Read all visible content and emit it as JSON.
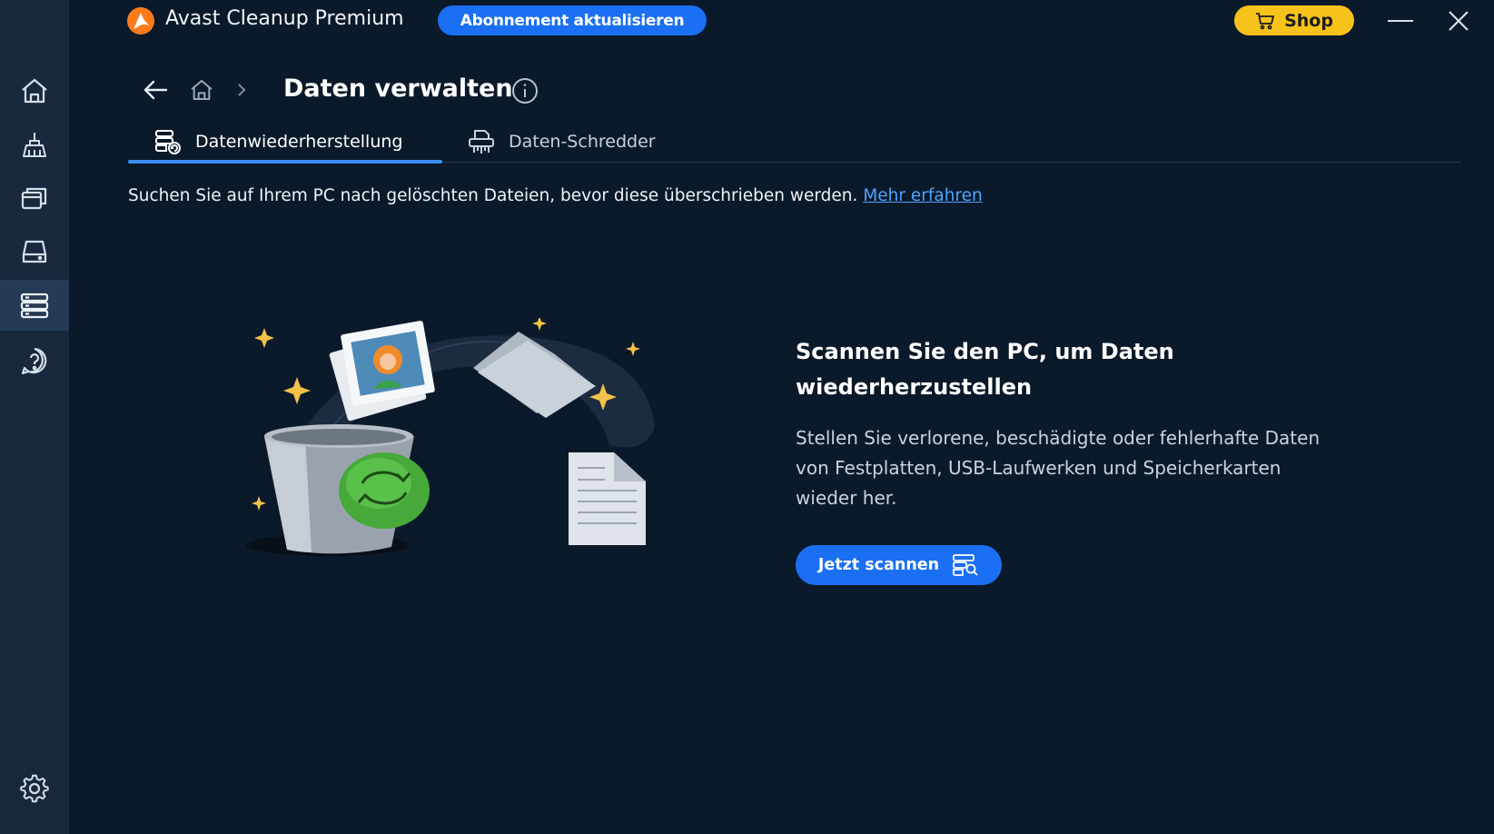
{
  "app": {
    "title": "Avast Cleanup Premium",
    "upgrade_label": "Abonnement aktualisieren",
    "shop_label": "Shop"
  },
  "sidebar": {
    "items": [
      {
        "icon": "home-icon",
        "active": false
      },
      {
        "icon": "broom-icon",
        "active": false
      },
      {
        "icon": "windows-icon",
        "active": false
      },
      {
        "icon": "drive-icon",
        "active": false
      },
      {
        "icon": "data-stack-icon",
        "active": true
      },
      {
        "icon": "help-icon",
        "active": false
      },
      {
        "icon": "gear-icon",
        "active": false
      }
    ]
  },
  "breadcrumb": {
    "title": "Daten verwalten"
  },
  "tabs": [
    {
      "label": "Datenwiederherstellung",
      "active": true,
      "icon": "data-recovery-icon"
    },
    {
      "label": "Daten-Schredder",
      "active": false,
      "icon": "shredder-icon"
    }
  ],
  "description": {
    "text": "Suchen Sie auf Ihrem PC nach gelöschten Dateien, bevor diese überschrieben werden.",
    "link": "Mehr erfahren"
  },
  "cta": {
    "title": "Scannen Sie den PC, um Daten wiederherzustellen",
    "body": "Stellen Sie verlorene, beschädigte oder fehlerhafte Daten von Festplatten, USB-Laufwerken und Speicherkarten wieder her.",
    "button": "Jetzt scannen"
  },
  "colors": {
    "accent": "#1a6ff2",
    "shop": "#f7c21a",
    "background": "#0b1a2a",
    "sidebar": "#18293d",
    "link": "#4fa3ff"
  }
}
